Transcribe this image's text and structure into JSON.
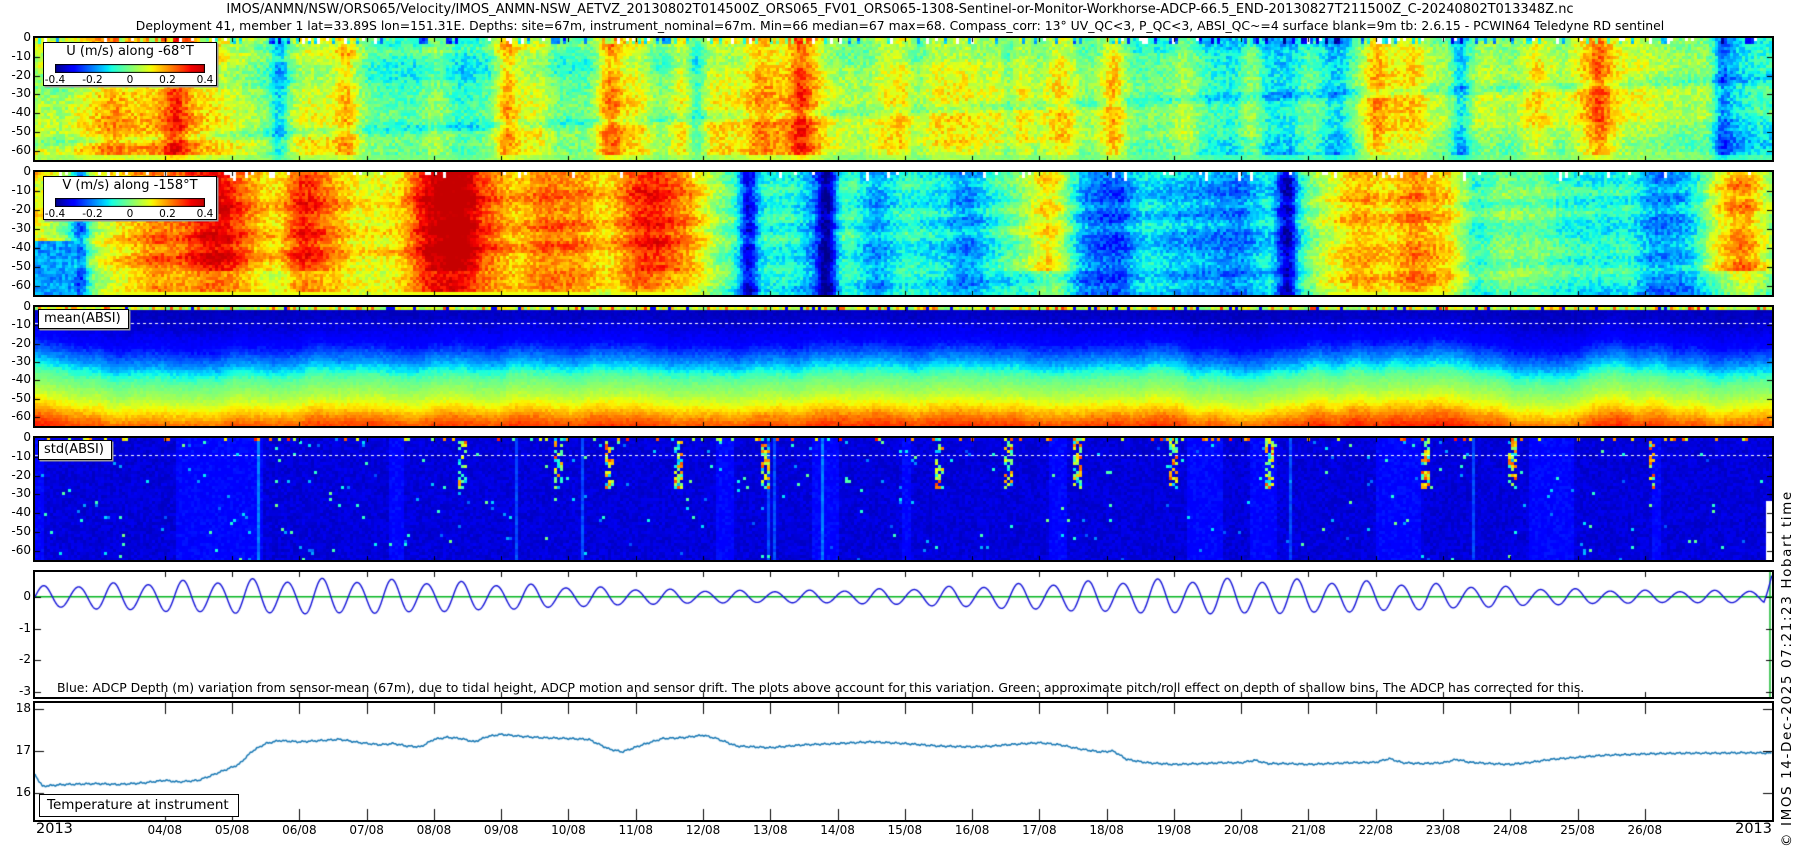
{
  "header": {
    "line1": "IMOS/ANMN/NSW/ORS065/Velocity/IMOS_ANMN-NSW_AETVZ_20130802T014500Z_ORS065_FV01_ORS065-1308-Sentinel-or-Monitor-Workhorse-ADCP-66.5_END-20130827T211500Z_C-20240802T013348Z.nc",
    "line2": "Deployment 41, member 1 lat=33.89S lon=151.31E. Depths: site=67m, instrument_nominal=67m. Min=66 median=67 max=68. Compass_corr: 13° UV_QC<3, P_QC<3, ABSI_QC~=4 surface blank=9m tb: 2.6.15 - PCWIN64 Teledyne RD sentinel"
  },
  "watermark": "© IMOS 14-Dec-2025 07:21:23 Hobart time",
  "x_axis": {
    "year_left": "2013",
    "year_right": "2013",
    "day_ticks": [
      "04/08",
      "05/08",
      "06/08",
      "07/08",
      "08/08",
      "09/08",
      "10/08",
      "11/08",
      "12/08",
      "13/08",
      "14/08",
      "15/08",
      "16/08",
      "17/08",
      "18/08",
      "19/08",
      "20/08",
      "21/08",
      "22/08",
      "23/08",
      "24/08",
      "25/08",
      "26/08"
    ],
    "day_numbers": [
      4,
      5,
      6,
      7,
      8,
      9,
      10,
      11,
      12,
      13,
      14,
      15,
      16,
      17,
      18,
      19,
      20,
      21,
      22,
      23,
      24,
      25,
      26
    ],
    "t_start_day": 2.07,
    "t_end_day": 27.89
  },
  "depth_axis": {
    "ticks": [
      0,
      -10,
      -20,
      -30,
      -40,
      -50,
      -60
    ],
    "range_m": [
      0,
      -65
    ]
  },
  "chart_data": [
    {
      "id": "u",
      "type": "heatmap",
      "title": "U (m/s) along -68°T",
      "colormap": "jet",
      "colorbar": {
        "min": -0.4,
        "max": 0.4,
        "ticks": [
          "-0.4",
          "-0.2",
          "0",
          "0.2",
          "0.4"
        ]
      },
      "ylabel_ticks": [
        0,
        -10,
        -20,
        -30,
        -40,
        -50,
        -60
      ],
      "description": "Eastward-rotated velocity component, mostly near 0 m/s (green) with weak yellow/blue vertical streaks; white dropout columns at surface.",
      "features": {
        "yellow_streak_fracs": [
          0.08,
          0.18,
          0.27,
          0.33,
          0.44,
          0.5,
          0.62,
          0.7,
          0.77,
          0.9
        ],
        "blue_dip_fracs": [
          0.14,
          0.38,
          0.56,
          0.82,
          0.97
        ]
      }
    },
    {
      "id": "v",
      "type": "heatmap",
      "title": "V (m/s) along -158°T",
      "colormap": "jet",
      "colorbar": {
        "min": -0.4,
        "max": 0.4,
        "ticks": [
          "-0.4",
          "-0.2",
          "0",
          "0.2",
          "0.4"
        ]
      },
      "ylabel_ticks": [
        0,
        -10,
        -20,
        -30,
        -40,
        -50,
        -60
      ],
      "description": "Alongshore velocity with broad alternating orange/red (poleward ~0.2-0.4 m/s) and green bands; strong dark-red event near 17/08.",
      "features": {
        "red_band_fracs": [
          0.105,
          0.155,
          0.24,
          0.36,
          0.578,
          0.975
        ],
        "red_band_amps": [
          0.2,
          0.16,
          0.2,
          0.18,
          0.3,
          0.24
        ],
        "cyan_dip_fracs": [
          0.025,
          0.41,
          0.455,
          0.72
        ]
      }
    },
    {
      "id": "mean_absi",
      "type": "heatmap",
      "label": "mean(ABSI)",
      "colormap": "jet",
      "ylabel_ticks": [
        0,
        -10,
        -20,
        -30,
        -40,
        -50,
        -60
      ],
      "blank_line_depth_m": -9,
      "description": "Mean acoustic backscatter: dark blue near surface grading to cyan/green mid-column and yellow/orange near the bottom; white dotted line at 9 m surface blank."
    },
    {
      "id": "std_absi",
      "type": "heatmap",
      "label": "std(ABSI)",
      "colormap": "jet",
      "ylabel_ticks": [
        0,
        -10,
        -20,
        -30,
        -40,
        -50,
        -60
      ],
      "blank_line_depth_m": -9,
      "description": "Backscatter standard deviation: uniform dark navy with sparse bright cyan/green/yellow streaks in the upper bins; white dotted line at 9 m.",
      "features": {
        "streak_fracs": [
          0.245,
          0.3,
          0.33,
          0.37,
          0.42,
          0.52,
          0.56,
          0.6,
          0.655,
          0.71,
          0.8,
          0.85,
          0.93
        ]
      }
    },
    {
      "id": "depth_variation",
      "type": "line",
      "note": "Blue: ADCP Depth (m) variation from sensor-mean (67m), due to tidal height, ADCP motion and sensor drift. The plots above account for this variation. Green: approximate pitch/roll effect on depth of shallow bins. The ADCP has corrected for this.",
      "ylim": [
        -3.15,
        0.78
      ],
      "yticks": [
        0,
        -1,
        -2,
        -3
      ],
      "series": [
        {
          "name": "adcp-depth-variation",
          "color": "#1212d8",
          "model": {
            "kind": "semidiurnal-tide",
            "period_days": 0.5175,
            "amp_base": 0.35,
            "amp_mod": 0.17,
            "spring_day": 6.1,
            "springneap_days": 13.7,
            "diurnal_inequality": 0.12,
            "end_rise": true
          }
        },
        {
          "name": "pitch-roll-effect",
          "color": "#00b41e",
          "value": 0
        }
      ]
    },
    {
      "id": "temperature",
      "type": "line",
      "label": "Temperature at instrument",
      "ylim": [
        15.35,
        18.15
      ],
      "yticks": [
        18,
        17,
        16
      ],
      "units": "degC",
      "series": [
        {
          "name": "temperature",
          "color": "#1878b4",
          "points": [
            [
              2.07,
              16.45
            ],
            [
              2.12,
              16.3
            ],
            [
              2.18,
              16.16
            ],
            [
              2.5,
              16.2
            ],
            [
              3.0,
              16.22
            ],
            [
              3.3,
              16.2
            ],
            [
              3.7,
              16.24
            ],
            [
              4.0,
              16.3
            ],
            [
              4.2,
              16.26
            ],
            [
              4.5,
              16.3
            ],
            [
              4.7,
              16.42
            ],
            [
              4.9,
              16.55
            ],
            [
              5.1,
              16.68
            ],
            [
              5.3,
              17.0
            ],
            [
              5.5,
              17.18
            ],
            [
              5.7,
              17.25
            ],
            [
              6.0,
              17.22
            ],
            [
              6.3,
              17.25
            ],
            [
              6.6,
              17.28
            ],
            [
              6.9,
              17.2
            ],
            [
              7.2,
              17.15
            ],
            [
              7.4,
              17.18
            ],
            [
              7.6,
              17.12
            ],
            [
              7.8,
              17.1
            ],
            [
              8.0,
              17.28
            ],
            [
              8.2,
              17.33
            ],
            [
              8.4,
              17.3
            ],
            [
              8.6,
              17.22
            ],
            [
              8.8,
              17.35
            ],
            [
              9.0,
              17.4
            ],
            [
              9.3,
              17.35
            ],
            [
              9.6,
              17.32
            ],
            [
              10.0,
              17.3
            ],
            [
              10.3,
              17.28
            ],
            [
              10.6,
              17.05
            ],
            [
              10.8,
              16.98
            ],
            [
              11.1,
              17.15
            ],
            [
              11.4,
              17.3
            ],
            [
              11.7,
              17.32
            ],
            [
              12.0,
              17.38
            ],
            [
              12.2,
              17.3
            ],
            [
              12.5,
              17.12
            ],
            [
              13.0,
              17.08
            ],
            [
              13.5,
              17.15
            ],
            [
              14.0,
              17.18
            ],
            [
              14.5,
              17.22
            ],
            [
              15.0,
              17.18
            ],
            [
              15.5,
              17.12
            ],
            [
              16.0,
              17.1
            ],
            [
              16.3,
              17.12
            ],
            [
              16.6,
              17.16
            ],
            [
              17.0,
              17.2
            ],
            [
              17.3,
              17.15
            ],
            [
              17.6,
              17.05
            ],
            [
              17.9,
              16.98
            ],
            [
              18.1,
              17.0
            ],
            [
              18.3,
              16.8
            ],
            [
              18.6,
              16.72
            ],
            [
              19.0,
              16.68
            ],
            [
              19.4,
              16.7
            ],
            [
              19.7,
              16.72
            ],
            [
              20.0,
              16.72
            ],
            [
              20.2,
              16.78
            ],
            [
              20.4,
              16.7
            ],
            [
              20.7,
              16.7
            ],
            [
              21.0,
              16.68
            ],
            [
              21.3,
              16.7
            ],
            [
              21.6,
              16.72
            ],
            [
              22.0,
              16.73
            ],
            [
              22.2,
              16.82
            ],
            [
              22.4,
              16.72
            ],
            [
              22.7,
              16.7
            ],
            [
              23.0,
              16.72
            ],
            [
              23.2,
              16.8
            ],
            [
              23.4,
              16.73
            ],
            [
              23.7,
              16.7
            ],
            [
              24.0,
              16.68
            ],
            [
              24.3,
              16.73
            ],
            [
              24.6,
              16.8
            ],
            [
              25.0,
              16.85
            ],
            [
              25.4,
              16.9
            ],
            [
              25.8,
              16.92
            ],
            [
              26.2,
              16.94
            ],
            [
              26.6,
              16.95
            ],
            [
              27.0,
              16.95
            ],
            [
              27.5,
              16.96
            ],
            [
              27.89,
              16.95
            ]
          ]
        }
      ]
    }
  ]
}
